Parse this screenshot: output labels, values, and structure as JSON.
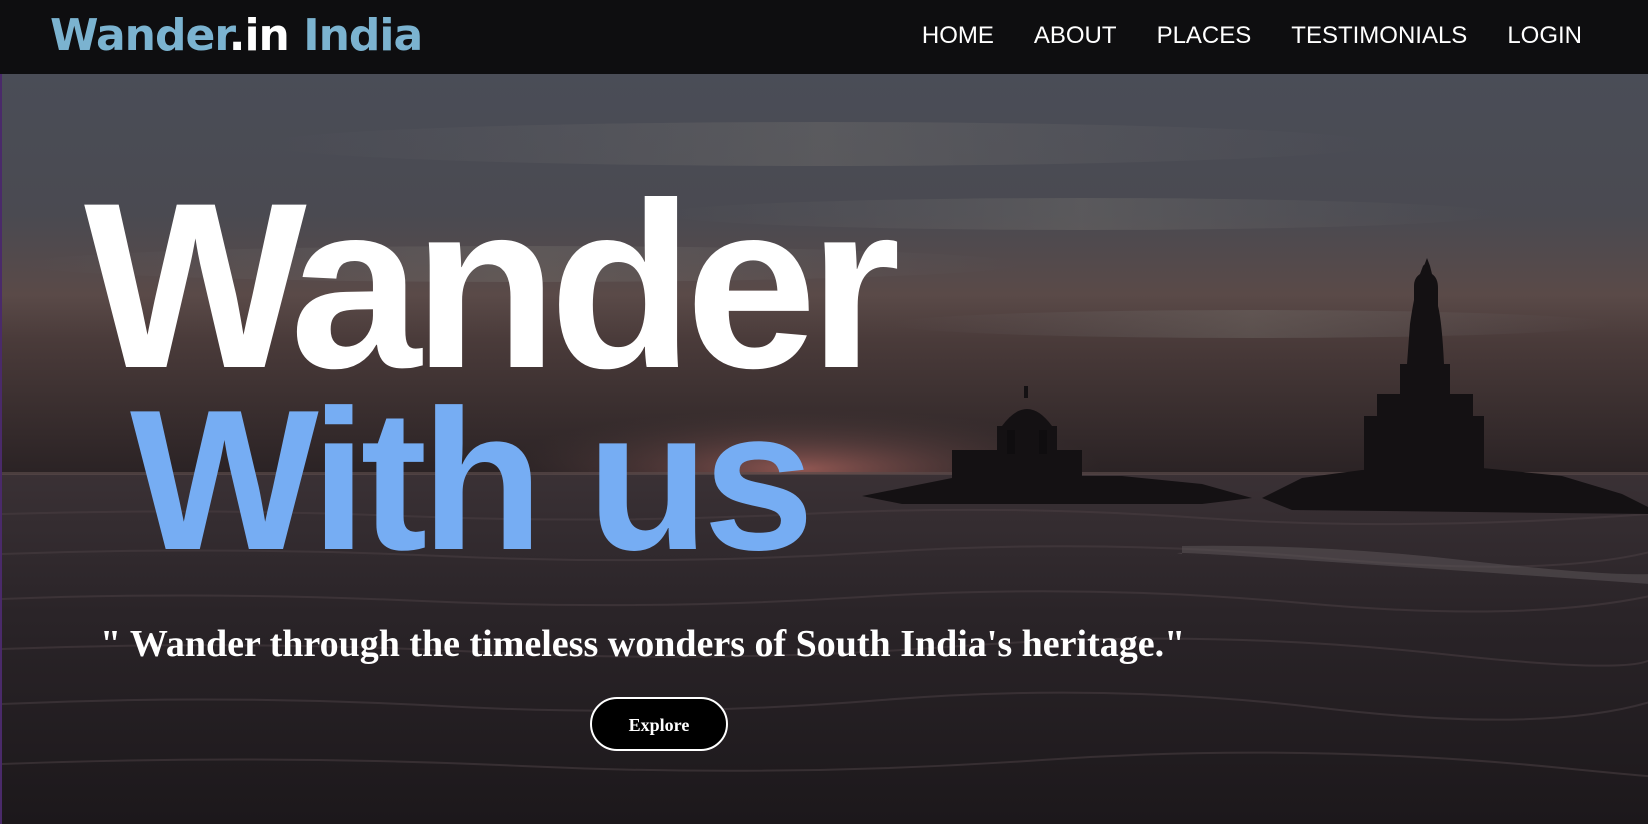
{
  "navbar": {
    "brand": {
      "part1": "Wander",
      "part2": ".in",
      "part3": " India"
    },
    "links": [
      {
        "label": "HOME"
      },
      {
        "label": "ABOUT"
      },
      {
        "label": "PLACES"
      },
      {
        "label": "TESTIMONIALS"
      },
      {
        "label": "LOGIN"
      }
    ]
  },
  "hero": {
    "headline_line1": "Wander",
    "headline_line2": "With us",
    "tagline": "\" Wander through the timeless wonders of South India's heritage.\"",
    "button_label": "Explore",
    "background_image": "sunset-sea-with-rock-memorial-and-statue-silhouette"
  },
  "colors": {
    "nav_background": "#0e0e10",
    "brand_accent": "#7bb3d0",
    "headline_secondary": "#76adf3",
    "text_primary": "#ffffff",
    "button_background": "#000000"
  }
}
